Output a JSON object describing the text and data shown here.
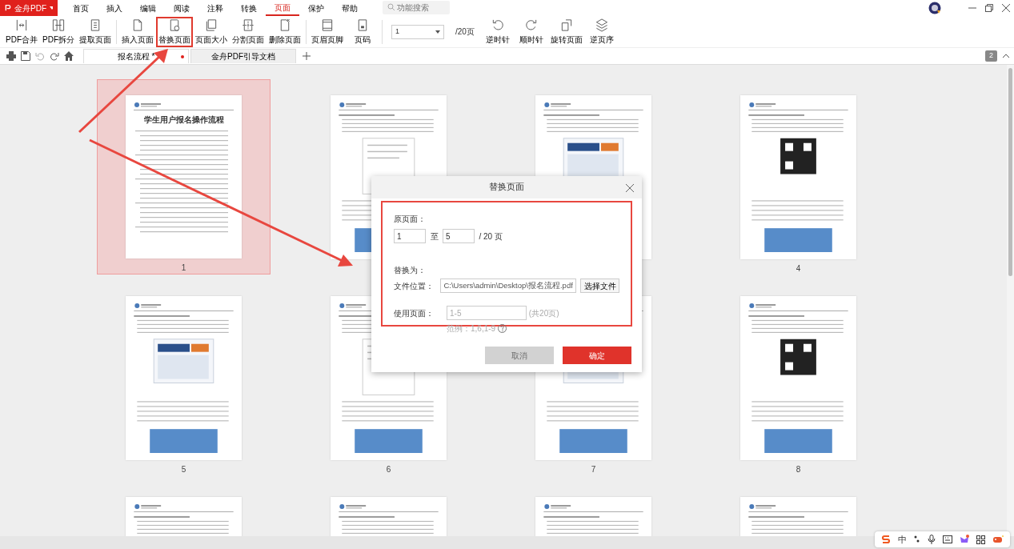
{
  "app_menu": {
    "label": "金舟PDF"
  },
  "menu_tabs": [
    {
      "label": "首页",
      "selected": false
    },
    {
      "label": "插入",
      "selected": false
    },
    {
      "label": "编辑",
      "selected": false
    },
    {
      "label": "阅读",
      "selected": false
    },
    {
      "label": "注释",
      "selected": false
    },
    {
      "label": "转换",
      "selected": false
    },
    {
      "label": "页面",
      "selected": true
    },
    {
      "label": "保护",
      "selected": false
    },
    {
      "label": "帮助",
      "selected": false
    }
  ],
  "search": {
    "placeholder": "功能搜索"
  },
  "toolbar": [
    {
      "kind": "button",
      "label": "PDF合并",
      "highlighted": false
    },
    {
      "kind": "button",
      "label": "PDF拆分",
      "highlighted": false
    },
    {
      "kind": "button",
      "label": "提取页面",
      "highlighted": false
    },
    {
      "kind": "separator"
    },
    {
      "kind": "button",
      "label": "插入页面",
      "highlighted": false
    },
    {
      "kind": "button",
      "label": "替换页面",
      "highlighted": true
    },
    {
      "kind": "button",
      "label": "页面大小",
      "highlighted": false
    },
    {
      "kind": "button",
      "label": "分割页面",
      "highlighted": false
    },
    {
      "kind": "button",
      "label": "删除页面",
      "highlighted": false
    },
    {
      "kind": "separator"
    },
    {
      "kind": "button",
      "label": "页眉页脚",
      "highlighted": false
    },
    {
      "kind": "button",
      "label": "页码",
      "highlighted": false
    },
    {
      "kind": "separator"
    },
    {
      "kind": "page_select",
      "value": "1",
      "total": "/20页"
    },
    {
      "kind": "button",
      "label": "逆时针",
      "highlighted": false
    },
    {
      "kind": "button",
      "label": "顺时针",
      "highlighted": false
    },
    {
      "kind": "button",
      "label": "旋转页面",
      "highlighted": false
    },
    {
      "kind": "button",
      "label": "逆页序",
      "highlighted": false
    }
  ],
  "doc_tabs": [
    {
      "label": "报名流程 *",
      "selected": true,
      "modified": true
    },
    {
      "label": "金舟PDF引导文档",
      "selected": false,
      "modified": false
    }
  ],
  "page_count_badge": "2",
  "pages": [
    {
      "number": "1",
      "selected": true,
      "title": "学生用户报名操作流程"
    },
    {
      "selected": false
    },
    {
      "selected": false
    },
    {
      "number": "4",
      "selected": false
    },
    {
      "number": "5",
      "selected": false
    },
    {
      "number": "6",
      "selected": false
    },
    {
      "number": "7",
      "selected": false
    },
    {
      "number": "8",
      "selected": false
    },
    {
      "selected": false
    },
    {
      "selected": false
    },
    {
      "selected": false
    },
    {
      "selected": false
    }
  ],
  "dialog": {
    "title": "替换页面",
    "highlighted": true,
    "source_label": "原页面：",
    "from": "1",
    "to_label": "至",
    "to": "5",
    "total": "/ 20 页",
    "replace_label": "替换为：",
    "file_label": "文件位置：",
    "file_path": "C:\\Users\\admin\\Desktop\\报名流程.pdf",
    "choose_button": "选择文件",
    "use_label": "使用页面：",
    "use_value": "1-5",
    "use_total": "(共20页)",
    "example": "范例：1,6,1-9",
    "buttons": [
      {
        "label": "取消",
        "kind": "secondary",
        "disabled": true
      },
      {
        "label": "确定",
        "kind": "primary",
        "disabled": false
      }
    ]
  },
  "ime_bar": {
    "mode": "中"
  }
}
